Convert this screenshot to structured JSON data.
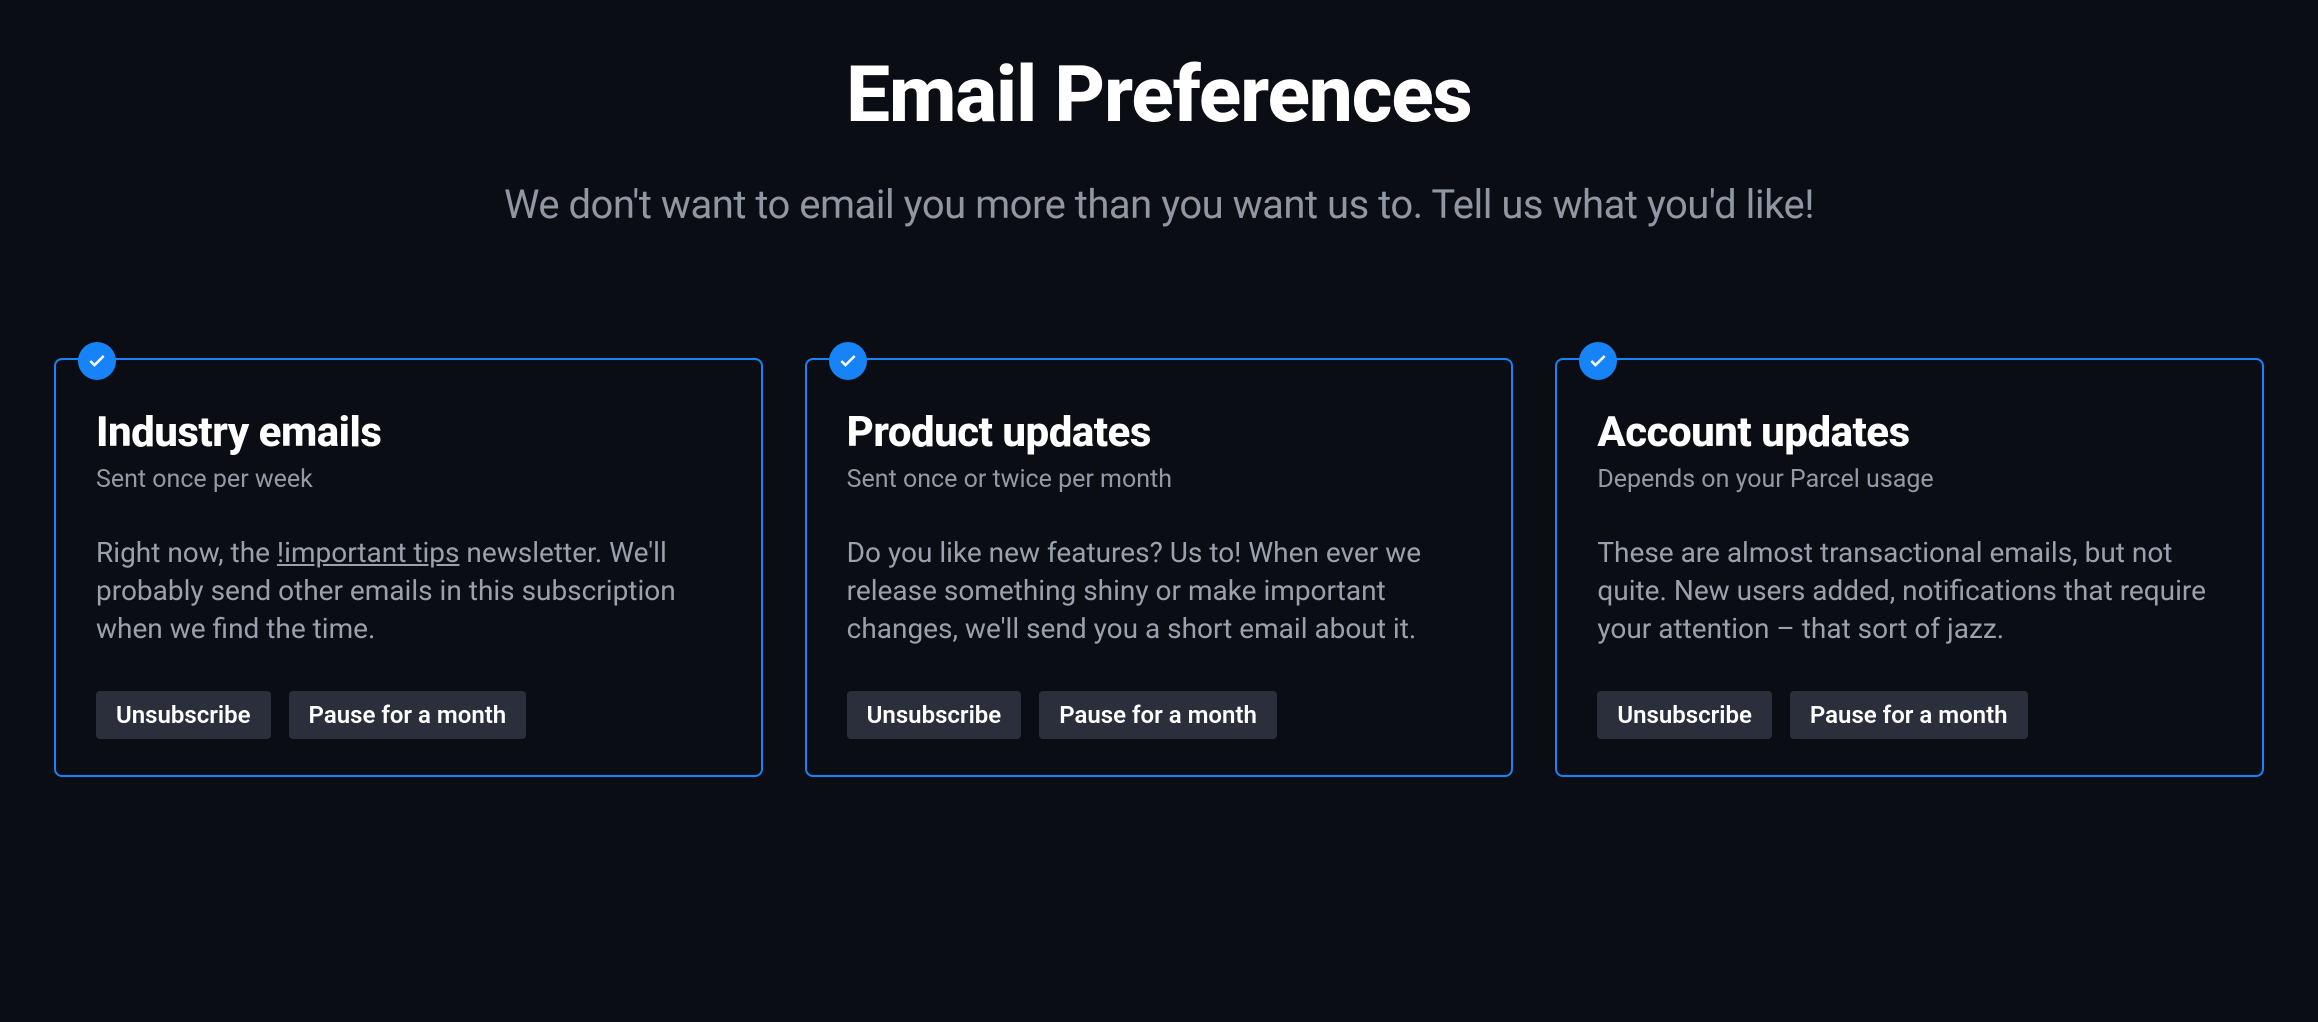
{
  "header": {
    "title": "Email Preferences",
    "subtitle": "We don't want to email you more than you want us to. Tell us what you'd like!"
  },
  "cards": [
    {
      "title": "Industry emails",
      "frequency": "Sent once per week",
      "descPrefix": "Right now, the ",
      "linkText": "!important tips",
      "descSuffix": " newsletter. We'll probably send other emails in this subscription when we find the time.",
      "unsubscribe": "Unsubscribe",
      "pause": "Pause for a month"
    },
    {
      "title": "Product updates",
      "frequency": "Sent once or twice per month",
      "description": "Do you like new features? Us to! When ever we release something shiny or make important changes, we'll send you a short email about it.",
      "unsubscribe": "Unsubscribe",
      "pause": "Pause for a month"
    },
    {
      "title": "Account updates",
      "frequency": "Depends on your Parcel usage",
      "description": "These are almost transactional emails, but not quite. New users added, notifications that require your attention – that sort of jazz.",
      "unsubscribe": "Unsubscribe",
      "pause": "Pause for a month"
    }
  ]
}
